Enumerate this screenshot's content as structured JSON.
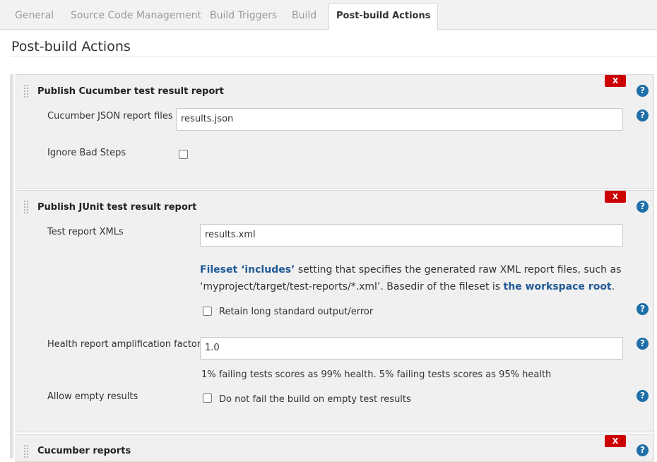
{
  "tabs": [
    {
      "label": "General"
    },
    {
      "label": "Source Code Management"
    },
    {
      "label": "Build Triggers"
    },
    {
      "label": "Build"
    },
    {
      "label": "Post-build Actions"
    }
  ],
  "page_title": "Post-build Actions",
  "delete_label": "X",
  "help_label": "?",
  "sections": [
    {
      "title": "Publish Cucumber test result report",
      "json_label": "Cucumber JSON report files",
      "json_value": "results.json",
      "ignore_label": "Ignore Bad Steps"
    },
    {
      "title": "Publish JUnit test result report",
      "xml_label": "Test report XMLs",
      "xml_value": "results.xml",
      "desc_link1": "Fileset ‘includes’",
      "desc_text1": " setting that specifies the generated raw XML report files, such as ‘myproject/target/test-reports/*.xml’. Basedir of the fileset is ",
      "desc_link2": "the workspace root",
      "desc_text2": ".",
      "retain_label": "Retain long standard output/error",
      "health_label": "Health report amplification factor",
      "health_value": "1.0",
      "health_hint": "1% failing tests scores as 99% health. 5% failing tests scores as 95% health",
      "empty_label": "Allow empty results",
      "empty_checkbox_label": "Do not fail the build on empty test results"
    },
    {
      "title": "Cucumber reports"
    }
  ],
  "colors": {
    "delete": "#cc0000",
    "help": "#1f6fa8",
    "link": "#1f5a96",
    "section_bg": "#f0f0f0"
  }
}
